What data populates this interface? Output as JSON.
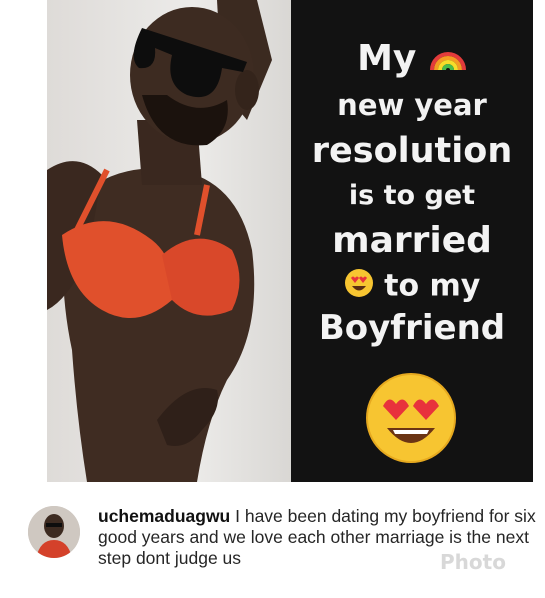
{
  "post_image": {
    "caption_lines": [
      "My",
      "new year",
      "resolution",
      "is to get",
      "married",
      "to my",
      "Boyfriend"
    ],
    "icons": [
      "rainbow-icon",
      "heart-eyes-emoji-icon",
      "heart-eyes-emoji-large-icon"
    ]
  },
  "comment": {
    "username": "uchemaduagwu",
    "text": " I have been dating my boyfriend for six good years and we love each other marriage is the next step dont judge us",
    "watermark": "Photo"
  },
  "colors": {
    "text_panel_bg": "#121212",
    "text_panel_fg": "#f3f3f3",
    "bra_color": "#e0502c"
  }
}
